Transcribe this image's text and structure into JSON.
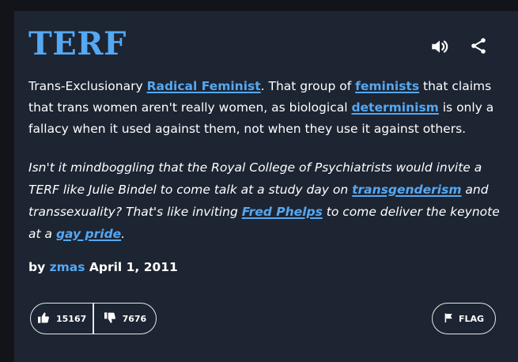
{
  "entry": {
    "word": "TERF",
    "meaning": {
      "t1": "Trans-Exclusionary ",
      "l1": "Radical Feminist",
      "t2": ". That group of ",
      "l2": "feminists",
      "t3": " that claims that trans women aren't really women, as biological ",
      "l3": "determinism",
      "t4": " is only a fallacy when it used against them, not when they use it against others."
    },
    "example": {
      "t1": "Isn't it mindboggling that the Royal College of Psychiatrists would invite a TERF like Julie Bindel to come talk at a study day on ",
      "l1": "transgenderism",
      "t2": " and transsexuality? That's like inviting ",
      "l2": "Fred Phelps",
      "t3": " to come deliver the keynote at a ",
      "l3": "gay pride",
      "t4": "."
    },
    "byline": {
      "prefix": "by ",
      "author": "zmas",
      "date": " April 1, 2011"
    },
    "votes": {
      "up": "15167",
      "down": "7676"
    },
    "flag_label": "FLAG"
  },
  "icons": {
    "speaker": "speaker-icon",
    "share": "share-icon",
    "thumbs_up": "thumbs-up-icon",
    "thumbs_down": "thumbs-down-icon",
    "flag": "flag-icon"
  },
  "colors": {
    "card_bg": "#1d2432",
    "page_bg": "#13141a",
    "accent": "#55a8f2",
    "text": "#ffffff"
  }
}
